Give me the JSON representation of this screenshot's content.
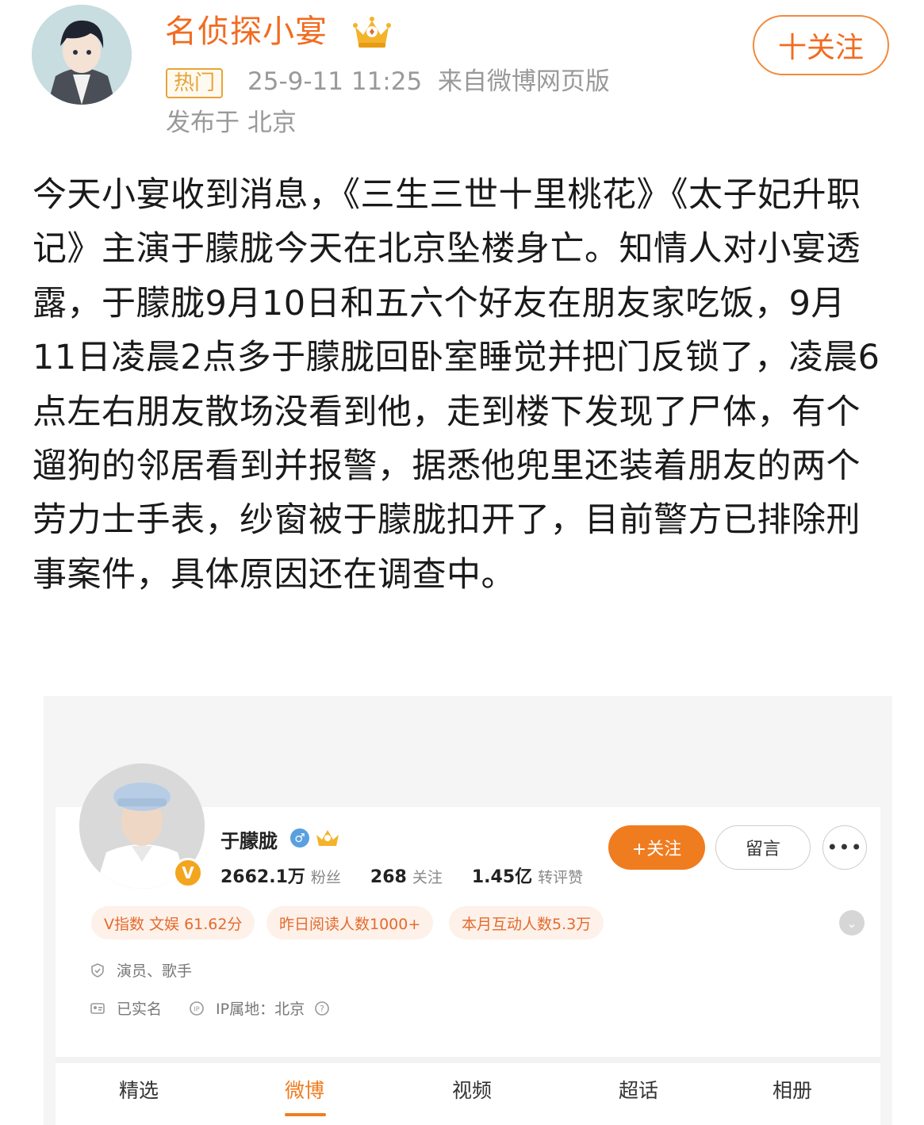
{
  "post": {
    "username": "名侦探小宴",
    "hot_label": "热门",
    "timestamp_source": "25-9-11 11:25  来自微博网页版",
    "location": "发布于 北京",
    "follow_label": "十关注",
    "text": "今天小宴收到消息，《三生三世十里桃花》《太子妃升职记》主演于朦胧今天在北京坠楼身亡。知情人对小宴透露，于朦胧9月10日和五六个好友在朋友家吃饭，9月11日凌晨2点多于朦胧回卧室睡觉并把门反锁了，凌晨6点左右朋友散场没看到他，走到楼下发现了尸体，有个遛狗的邻居看到并报警，据悉他兜里还装着朋友的两个劳力士手表，纱窗被于朦胧扣开了，目前警方已排除刑事案件，具体原因还在调查中。"
  },
  "profile": {
    "name": "于朦胧",
    "followers_value": "2662.1万",
    "followers_label": "粉丝",
    "following_value": "268",
    "following_label": "关注",
    "likes_value": "1.45亿",
    "likes_label": "转评赞",
    "follow_label": "+关注",
    "message_label": "留言",
    "more_label": "•••",
    "v_badge": "V",
    "tags": [
      "V指数 文娱 61.62分",
      "昨日阅读人数1000+",
      "本月互动人数5.3万"
    ],
    "occupation": "演员、歌手",
    "verified": "已实名",
    "ip_location": "IP属地：北京",
    "tabs": [
      "精选",
      "微博",
      "视频",
      "超话",
      "相册"
    ]
  },
  "colors": {
    "accent": "#f26b20",
    "hot_badge": "#e8a338",
    "follow_fill": "#f07c20",
    "tag_bg": "#fdf1ea",
    "meta_text": "#999999"
  }
}
